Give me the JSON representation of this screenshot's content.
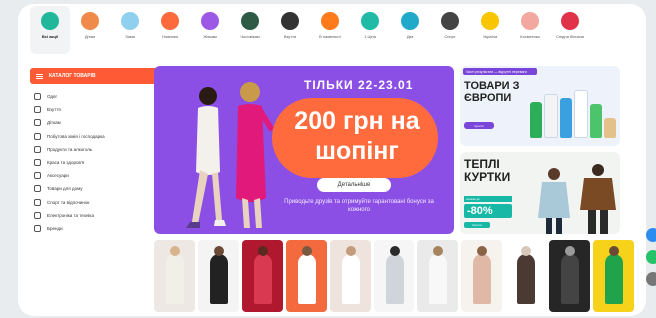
{
  "categories": [
    {
      "label": "Всі акції",
      "icon": "percent-icon",
      "color": "#21b79a",
      "active": true
    },
    {
      "label": "Дітям",
      "icon": "kids-clothes-icon",
      "color": "#f08a4b",
      "active": false
    },
    {
      "label": "Зима",
      "icon": "snowflake-icon",
      "color": "#8fd0ef",
      "active": false
    },
    {
      "label": "Новинки",
      "icon": "new-badge-icon",
      "color": "#ff6a3d",
      "active": false
    },
    {
      "label": "Жінкам",
      "icon": "dress-icon",
      "color": "#9b59e6",
      "active": false
    },
    {
      "label": "Чоловікам",
      "icon": "jacket-icon",
      "color": "#2f5a46",
      "active": false
    },
    {
      "label": "Взуття",
      "icon": "boot-icon",
      "color": "#333333",
      "active": false
    },
    {
      "label": "В наявності",
      "icon": "fire-icon",
      "color": "#ff7a1a",
      "active": false
    },
    {
      "label": "1 Ціна",
      "icon": "price-tag-icon",
      "color": "#1fbba6",
      "active": false
    },
    {
      "label": "Дім",
      "icon": "towel-icon",
      "color": "#20a9c9",
      "active": false
    },
    {
      "label": "Спорт",
      "icon": "ball-icon",
      "color": "#444444",
      "active": false
    },
    {
      "label": "Україна",
      "icon": "heart-flag-icon",
      "color": "#f7c600",
      "active": false
    },
    {
      "label": "Косметика",
      "icon": "cosmetics-icon",
      "color": "#f2a7a0",
      "active": false
    },
    {
      "label": "Спідня білизна",
      "icon": "bra-icon",
      "color": "#e0334a",
      "active": false
    }
  ],
  "sidebar": {
    "catalog_label": "КАТАЛОГ ТОВАРІВ",
    "items": [
      {
        "label": "Одяг",
        "icon": "shirt-icon"
      },
      {
        "label": "Взуття",
        "icon": "shoe-icon"
      },
      {
        "label": "Діткам",
        "icon": "kids-icon"
      },
      {
        "label": "Побутова хімія і господарка",
        "icon": "chemistry-icon"
      },
      {
        "label": "Продукти та алкоголь",
        "icon": "food-icon"
      },
      {
        "label": "Краса та здоров'я",
        "icon": "beauty-icon"
      },
      {
        "label": "Аксесуари",
        "icon": "bag-icon"
      },
      {
        "label": "Товари для дому",
        "icon": "home-icon"
      },
      {
        "label": "Спорт та відпочинок",
        "icon": "sport-icon"
      },
      {
        "label": "Електроніка та техніка",
        "icon": "electronics-icon"
      },
      {
        "label": "Бренди",
        "icon": "brand-icon"
      }
    ]
  },
  "banner": {
    "date": "ТІЛЬКИ 22-23.01",
    "headline": "200 грн на шопінг",
    "details_button": "Детальніше",
    "subtext": "Приводьте друзів та отримуйте гарантовані бонуси за кожного"
  },
  "promo1": {
    "tag": "Чисті результати — відчутні переваги",
    "title": "ТОВАРИ З ЄВРОПИ",
    "button": "Купити"
  },
  "promo2": {
    "title": "ТЕПЛІ КУРТКИ",
    "discount_caption": "знижки до",
    "discount": "-80%",
    "button": "Купити"
  },
  "colors": {
    "accent": "#ff5a36",
    "banner_bg": "#8c4fe6",
    "banner_bubble": "#ff6b3d",
    "teal": "#17b8a6"
  },
  "thumbnails": [
    {
      "bg": "#ede8e3",
      "figure": "#f2efe9",
      "head": "#d9b38c"
    },
    {
      "bg": "#f4f4f4",
      "figure": "#222222",
      "head": "#6b4a35"
    },
    {
      "bg": "#b0182f",
      "figure": "#d93a52",
      "head": "#5a2a20"
    },
    {
      "bg": "#f26a3e",
      "figure": "#ffffff",
      "head": "#7a5a40"
    },
    {
      "bg": "#efe4dd",
      "figure": "#ffffff",
      "head": "#c49c7c"
    },
    {
      "bg": "#f6f6f6",
      "figure": "#cfd5da",
      "head": "#2a2a2a"
    },
    {
      "bg": "#eaeaea",
      "figure": "#f8f8f8",
      "head": "#a8845e"
    },
    {
      "bg": "#f6f2ee",
      "figure": "#e0b9a6",
      "head": "#8a6246"
    },
    {
      "bg": "#ffffff",
      "figure": "#4a3a33",
      "head": "#d7c8bb"
    },
    {
      "bg": "#262626",
      "figure": "#444444",
      "head": "#9a9a9a"
    },
    {
      "bg": "#f7d21a",
      "figure": "#20a34a",
      "head": "#6b4a35"
    }
  ],
  "floating_buttons": [
    {
      "icon": "chat-icon",
      "color": "#2d8cf0"
    },
    {
      "icon": "whatsapp-icon",
      "color": "#25c26a"
    },
    {
      "icon": "phone-icon",
      "color": "#777777"
    }
  ]
}
